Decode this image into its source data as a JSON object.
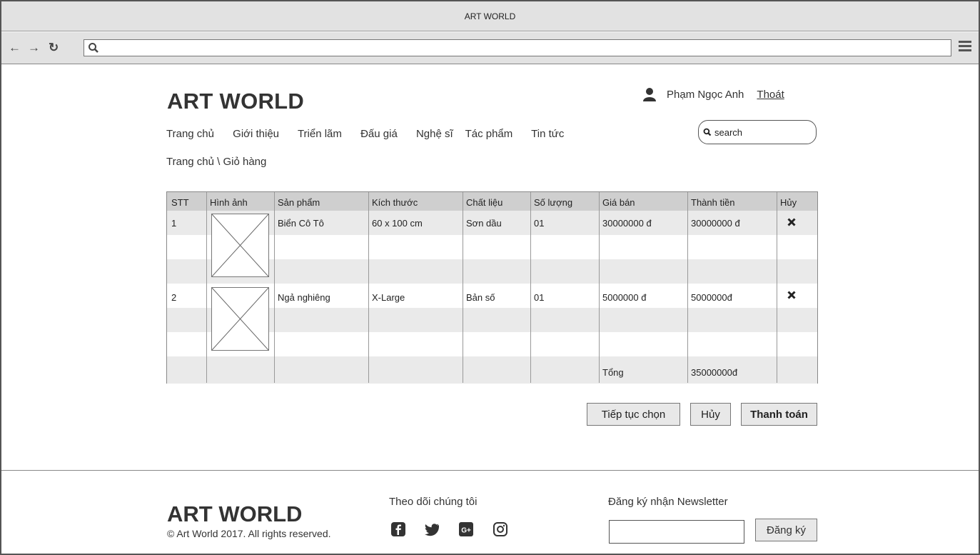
{
  "browser": {
    "title": "ART WORLD",
    "url": ""
  },
  "header": {
    "logo": "ART WORLD",
    "user_name": "Phạm Ngọc Anh",
    "logout": "Thoát",
    "search_placeholder": "search"
  },
  "nav": {
    "items": [
      "Trang chủ",
      "Giới thiệu",
      "Triển lãm",
      "Đấu giá",
      "Nghệ sĩ",
      "Tác phẩm",
      "Tin tức"
    ]
  },
  "breadcrumb": "Trang chủ \\ Giỏ hàng",
  "cart": {
    "columns": [
      "STT",
      "Hình ảnh",
      "Sản phẩm",
      "Kích thước",
      "Chất liệu",
      "Số lượng",
      "Giá bán",
      "Thành tiền",
      "Hủy"
    ],
    "rows": [
      {
        "stt": "1",
        "product": "Biển Cô Tô",
        "size": "60 x 100 cm",
        "material": "Sơn dầu",
        "qty": "01",
        "price": "30000000 đ",
        "total": "30000000 đ"
      },
      {
        "stt": "2",
        "product": "Ngả nghiêng",
        "size": "X-Large",
        "material": "Bản số",
        "qty": "01",
        "price": "5000000 đ",
        "total": "5000000đ"
      }
    ],
    "total_label": "Tổng",
    "total_value": "35000000đ"
  },
  "actions": {
    "continue": "Tiếp tục chọn",
    "cancel": "Hủy",
    "checkout": "Thanh toán"
  },
  "footer": {
    "logo": "ART WORLD",
    "copyright": "© Art World 2017. All rights reserved.",
    "follow_title": "Theo dõi chúng tôi",
    "social": [
      "facebook-icon",
      "twitter-icon",
      "google-plus-icon",
      "instagram-icon"
    ],
    "newsletter_title": "Đăng ký nhận Newsletter",
    "newsletter_value": "",
    "newsletter_button": "Đăng ký"
  }
}
